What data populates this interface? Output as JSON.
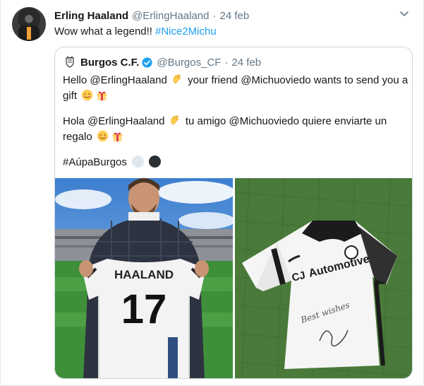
{
  "tweet": {
    "author_name": "Erling Haaland",
    "author_handle": "@ErlingHaaland",
    "separator": "·",
    "date": "24 feb",
    "text": "Wow what a legend!!",
    "hashtag": "#Nice2Michu"
  },
  "quoted": {
    "author_name": "Burgos C.F.",
    "author_handle": "@Burgos_CF",
    "separator": "·",
    "date": "24 feb",
    "line1_a": "Hello @ErlingHaaland",
    "line1_b": "your friend @Michuoviedo wants to send you a",
    "line2": "gift",
    "line3_a": "Hola @ErlingHaaland",
    "line3_b": "tu amigo @Michuoviedo quiere enviarte un",
    "line4": "regalo",
    "hashtag": "#AúpaBurgos",
    "jersey_left_name": "HAALAND",
    "jersey_left_number": "17",
    "jersey_right_sponsor": "Automotive",
    "jersey_right_sponsor_prefix": "CJ",
    "jersey_right_signature": "Best wishes"
  },
  "colors": {
    "link": "#1da1f2",
    "muted": "#657786",
    "verified": "#1da1f2",
    "border": "#ccd6dd"
  },
  "icons": [
    "chevron-down-icon",
    "verified-icon",
    "clapping-hands-icon",
    "smiling-face-icon",
    "gift-icon",
    "white-circle-icon",
    "black-circle-icon"
  ]
}
